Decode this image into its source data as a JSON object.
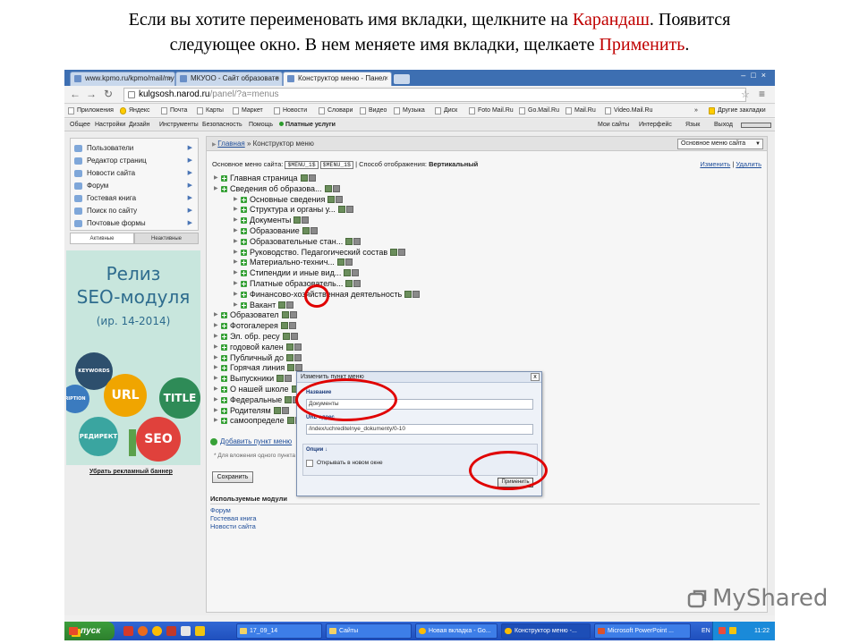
{
  "caption": {
    "line1_a": "Если вы хотите переименовать имя вкладки, щелкните на ",
    "line1_red": "Карандаш",
    "line1_b": ". Появится",
    "line2_a": "следующее окно. В нем меняете имя вкладки, щелкаете ",
    "line2_red": "Применить",
    "line2_b": "."
  },
  "browser": {
    "tabs": [
      {
        "label": "www.kpmo.ru/kpmo/mail/my"
      },
      {
        "label": "МКУОО - Сайт образовате"
      },
      {
        "label": "Конструктор меню - Панел"
      }
    ],
    "url_host": "kulgsosh.narod.ru",
    "url_path": "/panel/?a=menus"
  },
  "bookmarks": [
    "Приложения",
    "Яндекс",
    "Почта",
    "Карты",
    "Маркет",
    "Новости",
    "Словари",
    "Видео",
    "Музыка",
    "Диск",
    "Foto Mail.Ru",
    "Go.Mail.Ru",
    "Mail.Ru",
    "Video.Mail.Ru",
    "»",
    "Другие закладки"
  ],
  "sitebar": {
    "left": [
      "Общее",
      "Настройки",
      "Дизайн",
      "Инструменты",
      "Безопасность",
      "Помощь"
    ],
    "paid": "Платные услуги",
    "right": [
      "Мои сайты",
      "Интерфейс",
      "Язык",
      "Выход"
    ]
  },
  "leftmenu": {
    "items": [
      "Пользователи",
      "Редактор страниц",
      "Новости сайта",
      "Форум",
      "Гостевая книга",
      "Поиск по сайту",
      "Почтовые формы"
    ],
    "tab_active": "Активные",
    "tab_inactive": "Неактивные"
  },
  "banner": {
    "title1": "Релиз",
    "title2": "SEO-модуля",
    "title3": "(ир. 14-2014)",
    "bubbles": [
      "KEYWORDS",
      "RIPTION",
      "URL",
      "TITLE",
      "РЕДИРЕКТ",
      "SEO"
    ],
    "remove_link": "Убрать рекламный баннер"
  },
  "main": {
    "crumb_home": "Главная",
    "crumb_sep": " » ",
    "crumb_current": "Конструктор меню",
    "menu_select": "Основное меню сайта",
    "info_label": "Основное меню сайта:",
    "tag1": "$MENU_1$",
    "tag2": "$MENU_1$",
    "info_mode_label": "| Способ отображения:",
    "info_mode": "Вертикальный",
    "action_edit": "Изменить",
    "action_sep": "|",
    "action_delete": "Удалить",
    "add_item": "Добавить пункт меню",
    "hint": "* Для вложения одного пункта меню в другой перетащите нужный пункт меню, удерживая его за",
    "save": "Сохранить",
    "modules_title": "Используемые модули",
    "modules": [
      "Форум",
      "Гостевая книга",
      "Новости сайта"
    ]
  },
  "tree": [
    {
      "label": "Главная страница",
      "level": 0
    },
    {
      "label": "Сведения об образова...",
      "level": 0
    },
    {
      "label": "Основные сведения",
      "level": 1
    },
    {
      "label": "Структура и органы у...",
      "level": 1
    },
    {
      "label": "Документы",
      "level": 1
    },
    {
      "label": "Образование",
      "level": 1
    },
    {
      "label": "Образовательные стан...",
      "level": 1
    },
    {
      "label": "Руководство. Педагогический состав",
      "level": 1
    },
    {
      "label": "Материально-технич...",
      "level": 1
    },
    {
      "label": "Стипендии и иные вид...",
      "level": 1
    },
    {
      "label": "Платные образователь...",
      "level": 1
    },
    {
      "label": "Финансово-хозяйственная деятельность",
      "level": 1
    },
    {
      "label": "Вакант",
      "level": 1
    },
    {
      "label": "Образовател",
      "level": 0
    },
    {
      "label": "Фотогалерея",
      "level": 0
    },
    {
      "label": "Эл. обр. ресу",
      "level": 0
    },
    {
      "label": "годовой кален",
      "level": 0
    },
    {
      "label": "Публичный до",
      "level": 0
    },
    {
      "label": "Горячая линия",
      "level": 0
    },
    {
      "label": "Выпускники",
      "level": 0
    },
    {
      "label": "О нашей школе",
      "level": 0
    },
    {
      "label": "Федеральные",
      "level": 0
    },
    {
      "label": "Родителям",
      "level": 0
    },
    {
      "label": "самоопределе",
      "level": 0
    }
  ],
  "dialog": {
    "title": "Изменить пункт меню",
    "close": "x",
    "name_label": "Название",
    "name_value": "Документы",
    "url_label": "URL-адрес",
    "url_value": "/index/uchreditelnye_dokumenty/0-10",
    "options_label": "Опции ↓",
    "new_window": "Открывать в новом окне",
    "apply": "Применить"
  },
  "taskbar": {
    "start": "пуск",
    "tasks": [
      "17_09_14",
      "Сайты",
      "Новая вкладка - Go...",
      "Конструктор меню -...",
      "Microsoft PowerPoint ..."
    ],
    "lang": "EN",
    "time": "11:22"
  },
  "watermark": "MyShared"
}
